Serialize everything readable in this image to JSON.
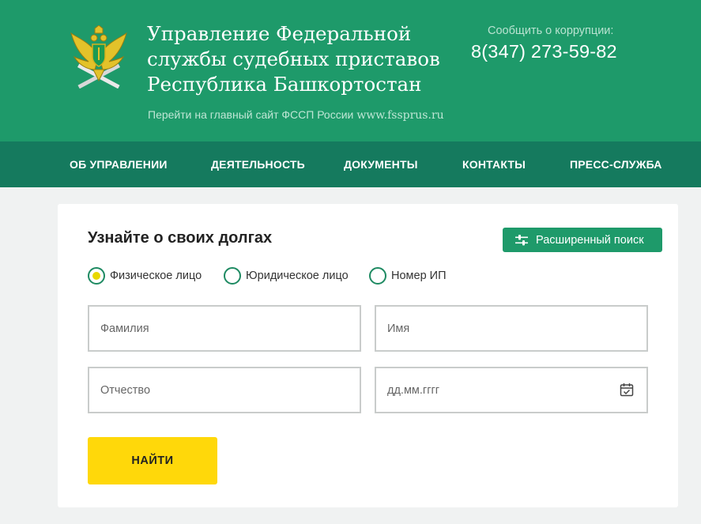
{
  "header": {
    "org_title": "Управление Федеральной\nслужбы судебных приставов\nРеспублика Башкортостан",
    "main_site_text": "Перейти на главный сайт ФССП России",
    "main_site_url": "www.fssprus.ru",
    "corruption_label": "Сообщить о коррупции:",
    "phone": "8(347) 273-59-82",
    "emblem_icon": "fssp-eagle-emblem-icon",
    "colors": {
      "header_bg": "#1e9a6a",
      "nav_bg": "#157a5e",
      "accent_yellow": "#ffd80a"
    }
  },
  "nav": {
    "items": [
      {
        "label": "ОБ УПРАВЛЕНИИ"
      },
      {
        "label": "ДЕЯТЕЛЬНОСТЬ"
      },
      {
        "label": "ДОКУМЕНТЫ"
      },
      {
        "label": "КОНТАКТЫ"
      },
      {
        "label": "ПРЕСС-СЛУЖБА"
      }
    ]
  },
  "search": {
    "title": "Узнайте о своих долгах",
    "advanced_button": "Расширенный поиск",
    "advanced_icon": "sliders-icon",
    "radios": [
      {
        "label": "Физическое лицо",
        "checked": true
      },
      {
        "label": "Юридическое лицо",
        "checked": false
      },
      {
        "label": "Номер ИП",
        "checked": false
      }
    ],
    "fields": {
      "last_name": "Фамилия",
      "first_name": "Имя",
      "patronymic": "Отчество",
      "birth_date": "дд.мм.гггг"
    },
    "calendar_icon": "calendar-check-icon",
    "submit": "НАЙТИ"
  }
}
